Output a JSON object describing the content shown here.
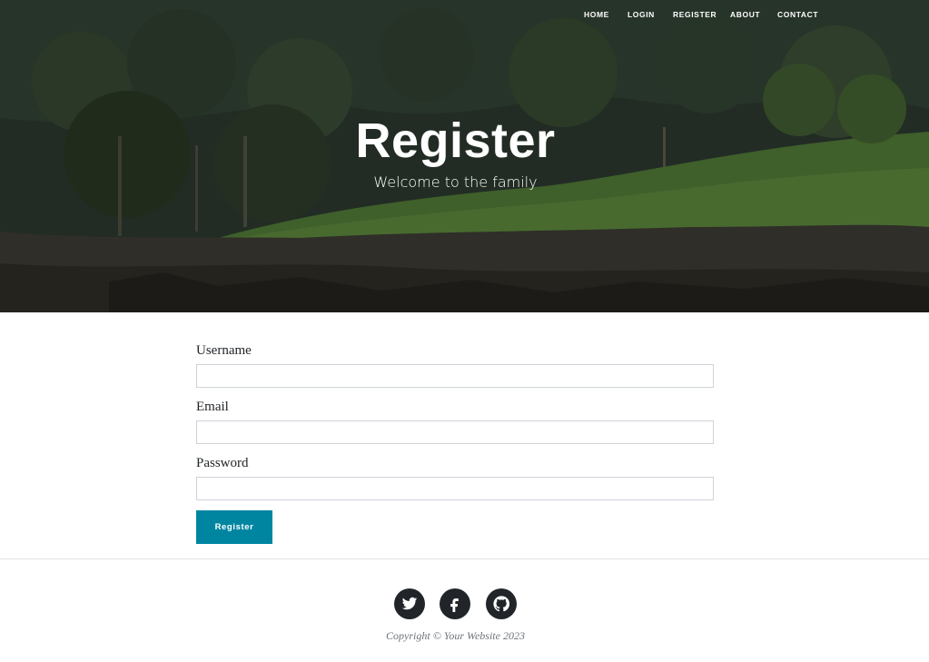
{
  "nav": {
    "items": [
      {
        "label": "HOME"
      },
      {
        "label": "LOGIN"
      },
      {
        "label": "REGISTER"
      },
      {
        "label": "ABOUT"
      },
      {
        "label": "CONTACT"
      }
    ]
  },
  "hero": {
    "title": "Register",
    "subtitle": "Welcome to the family"
  },
  "form": {
    "username": {
      "label": "Username",
      "value": "",
      "placeholder": ""
    },
    "email": {
      "label": "Email",
      "value": "",
      "placeholder": ""
    },
    "password": {
      "label": "Password",
      "value": "",
      "placeholder": ""
    },
    "submit_label": "Register"
  },
  "footer": {
    "socials": [
      {
        "icon": "twitter-icon"
      },
      {
        "icon": "facebook-icon"
      },
      {
        "icon": "github-icon"
      }
    ],
    "copyright": "Copyright © Your Website 2023"
  },
  "colors": {
    "accent": "#0085a1",
    "social_bg": "#212529",
    "muted_text": "#6c757d"
  }
}
